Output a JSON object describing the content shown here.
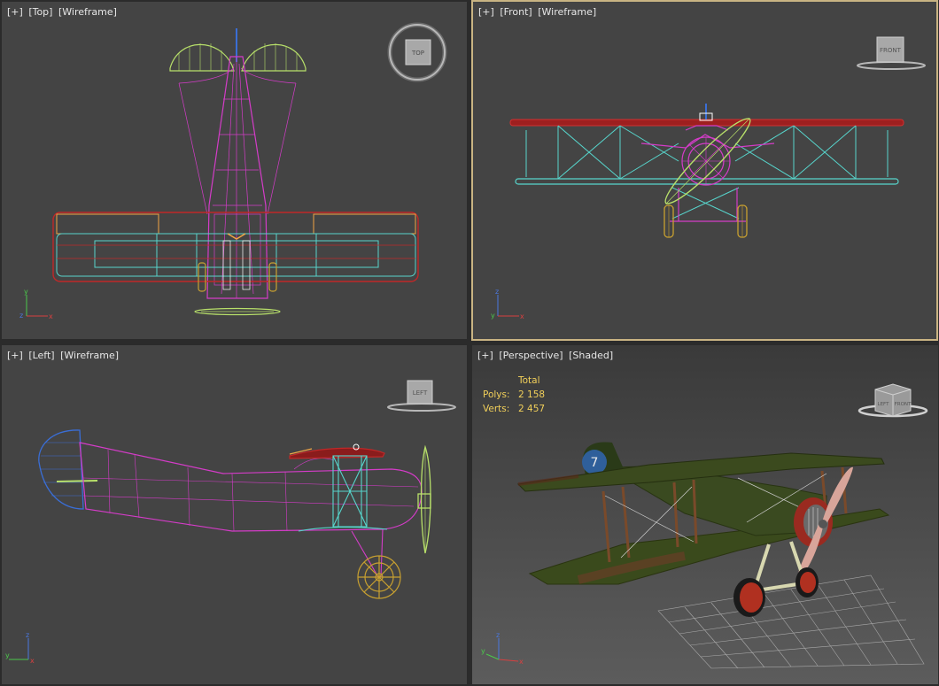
{
  "viewports": {
    "top": {
      "menu": "[+]",
      "view": "[Top]",
      "mode": "[Wireframe]",
      "cube": "TOP"
    },
    "front": {
      "menu": "[+]",
      "view": "[Front]",
      "mode": "[Wireframe]",
      "cube": "FRONT"
    },
    "left": {
      "menu": "[+]",
      "view": "[Left]",
      "mode": "[Wireframe]",
      "cube": "LEFT"
    },
    "persp": {
      "menu": "[+]",
      "view": "[Perspective]",
      "mode": "[Shaded]",
      "cube_left": "LEFT",
      "cube_right": "FRONT"
    }
  },
  "stats": {
    "header": "Total",
    "polys_label": "Polys:",
    "polys_value": "2 158",
    "verts_label": "Verts:",
    "verts_value": "2 457"
  },
  "aircraft": {
    "number": "7"
  },
  "axes": {
    "x": "x",
    "y": "y",
    "z": "z"
  },
  "colors": {
    "viewport_bg": "#444444",
    "active_border": "#c9b483",
    "fuselage_wire": "#d43cc8",
    "strut_wire": "#57d5cc",
    "wing_wire": "#c02828",
    "propeller_wire": "#b8e06a",
    "wheel_wire": "#c8a030",
    "stats_text": "#f2d05a"
  }
}
